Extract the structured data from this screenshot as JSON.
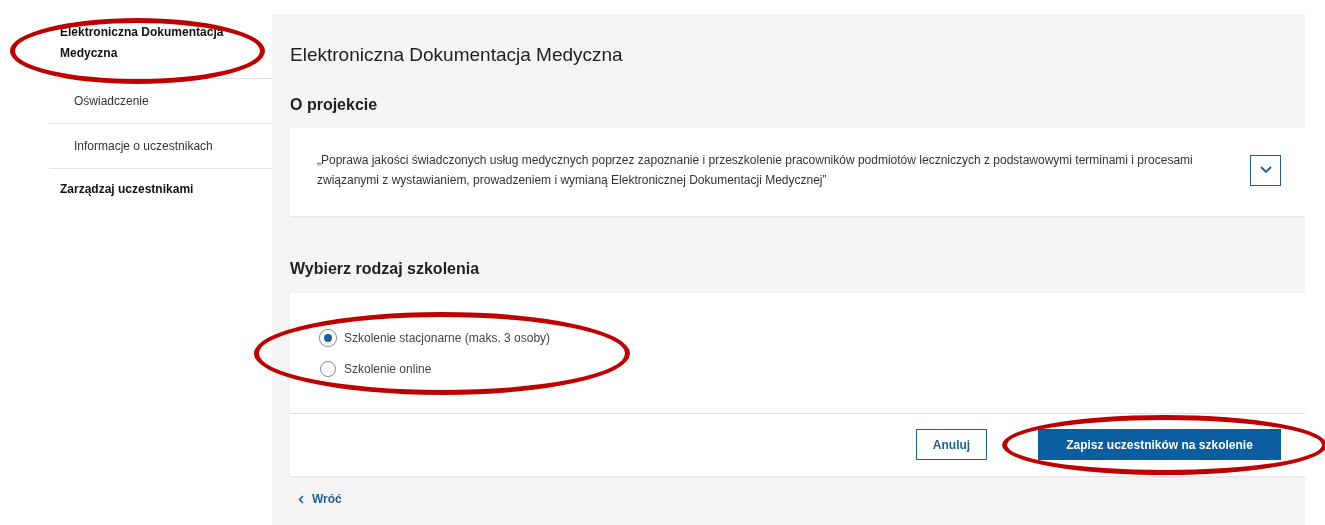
{
  "sidebar": {
    "items": [
      {
        "label": "Elektroniczna Dokumentacja Medyczna",
        "kind": "section",
        "circled": true
      },
      {
        "label": "Oświadczenie",
        "kind": "subitem"
      },
      {
        "label": "Informacje o uczestnikach",
        "kind": "subitem"
      },
      {
        "label": "Zarządzaj uczestnikami",
        "kind": "section"
      }
    ]
  },
  "page_title": "Elektroniczna Dokumentacja Medyczna",
  "about": {
    "heading": "O projekcie",
    "text": "„Poprawa jakości świadczonych usług medycznych poprzez zapoznanie i przeszkolenie pracowników podmiotów leczniczych z podstawowymi terminami i procesami związanymi z wystawianiem, prowadzeniem i wymianą Elektronicznej Dokumentacji Medycznej”",
    "expanded": false
  },
  "training": {
    "heading": "Wybierz rodzaj szkolenia",
    "circled": true,
    "options": [
      {
        "label": "Szkolenie stacjonarne (maks. 3 osoby)",
        "selected": true
      },
      {
        "label": "Szkolenie online",
        "selected": false
      }
    ]
  },
  "buttons": [
    {
      "label": "Anuluj",
      "kind": "secondary"
    },
    {
      "label": "Zapisz uczestników na szkolenie",
      "kind": "primary",
      "circled": true
    }
  ],
  "back_link": {
    "label": "Wróć"
  }
}
